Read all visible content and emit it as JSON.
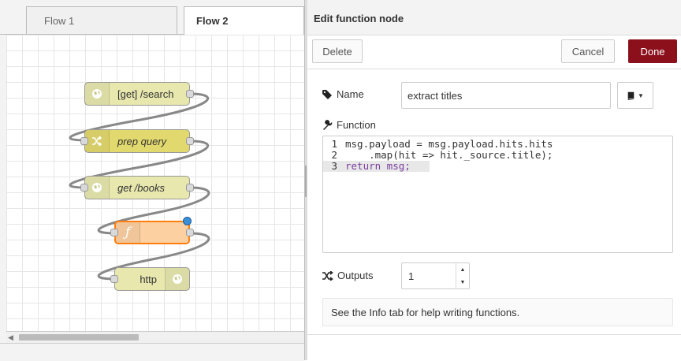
{
  "workspace": {
    "tabs": [
      {
        "label": "Flow 1",
        "active": false
      },
      {
        "label": "Flow 2",
        "active": true
      }
    ]
  },
  "nodes": [
    {
      "label": "[get] /search",
      "type": "http-in",
      "icon": "globe-icon",
      "color": "#e7e7ae"
    },
    {
      "label": "prep query",
      "type": "change",
      "icon": "shuffle-icon",
      "color": "#e2d96e",
      "italic": true
    },
    {
      "label": "get /books",
      "type": "http-request",
      "icon": "globe-icon",
      "color": "#e7e7ae",
      "italic": true
    },
    {
      "label": "",
      "type": "function",
      "icon": "function-icon",
      "color": "#fdd0a2",
      "selected": true
    },
    {
      "label": "http",
      "type": "http-response",
      "icon": "globe-icon",
      "color": "#e7e7ae"
    }
  ],
  "panel": {
    "title": "Edit function node",
    "delete_label": "Delete",
    "cancel_label": "Cancel",
    "done_label": "Done",
    "name_label": "Name",
    "name_value": "extract titles",
    "function_label": "Function",
    "code": [
      {
        "num": "1",
        "text": "msg.payload = msg.payload.hits.hits"
      },
      {
        "num": "2",
        "text": "    .map(hit => hit._source.title);"
      },
      {
        "num": "3",
        "text": "return msg;"
      }
    ],
    "outputs_label": "Outputs",
    "outputs_value": "1",
    "tip": "See the Info tab for help writing functions."
  },
  "colors": {
    "done_button": "#8c101c",
    "selected_node_border": "#ff7f0e",
    "status_dot": "#3a8ed8"
  }
}
